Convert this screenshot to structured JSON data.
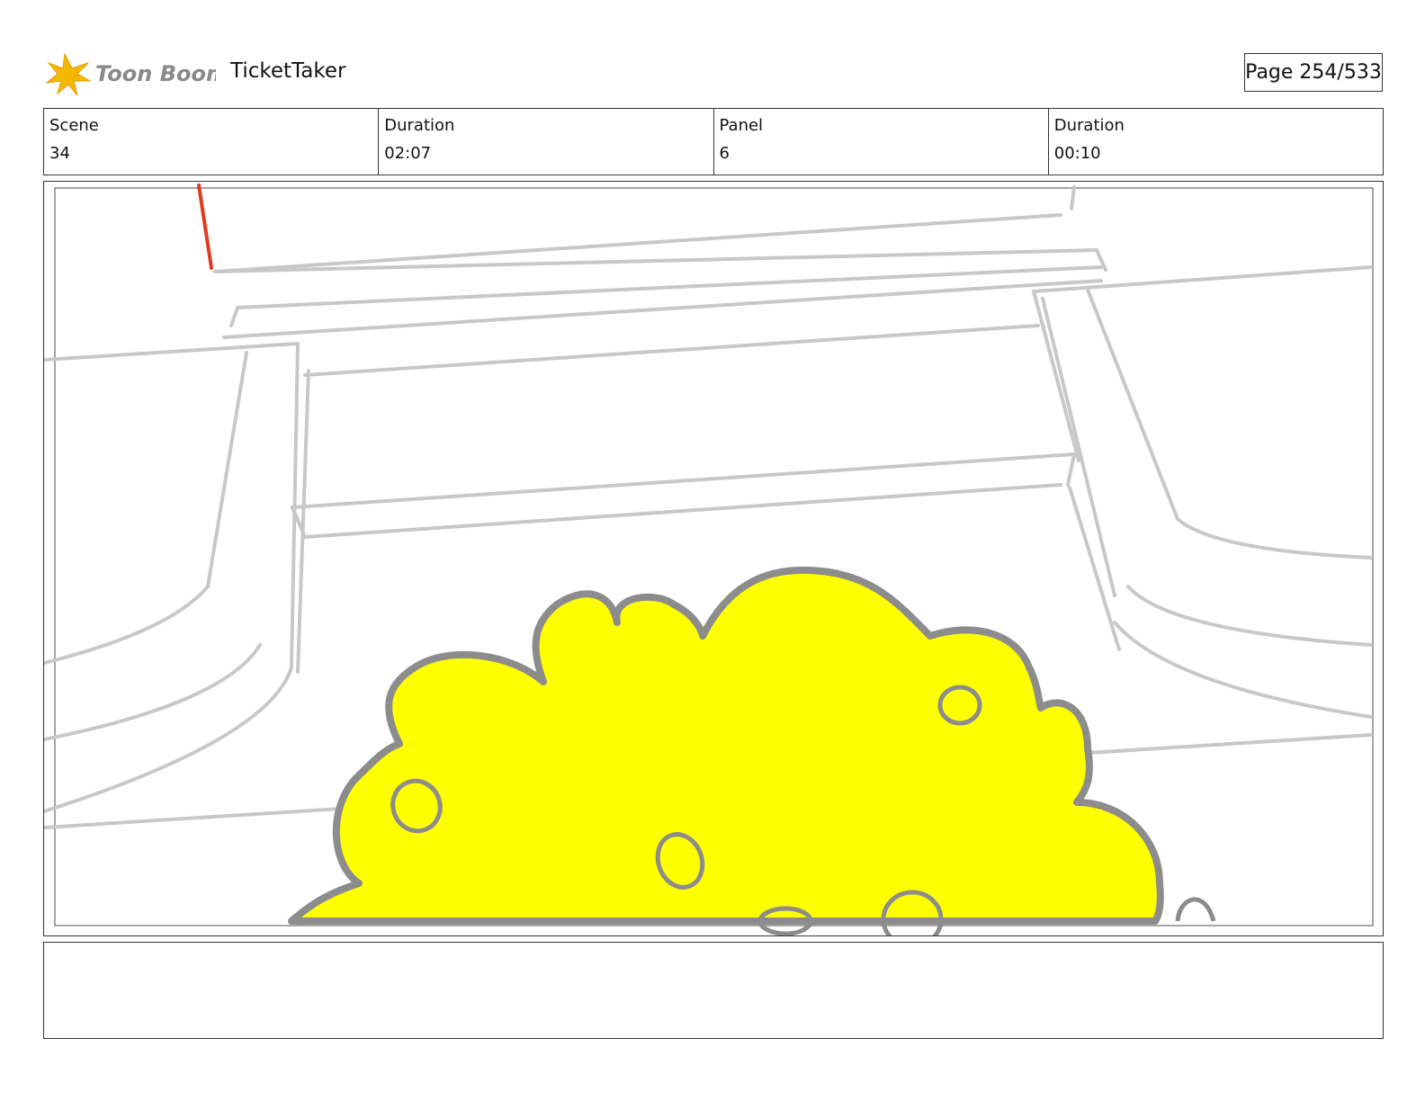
{
  "header": {
    "logo_text": "Toon Boom",
    "project_title": "TicketTaker",
    "page_label": "Page 254/533"
  },
  "info": {
    "scene_label": "Scene",
    "scene_value": "34",
    "scene_duration_label": "Duration",
    "scene_duration_value": "02:07",
    "panel_label": "Panel",
    "panel_value": "6",
    "panel_duration_label": "Duration",
    "panel_duration_value": "00:10"
  },
  "panel": {
    "sketch_line_color": "#c8c8c8",
    "cloud_fill_color": "#ffff00",
    "cloud_outline_color": "#8c8c8c",
    "marker_color": "#e03a1e"
  },
  "notes": {
    "text": ""
  }
}
